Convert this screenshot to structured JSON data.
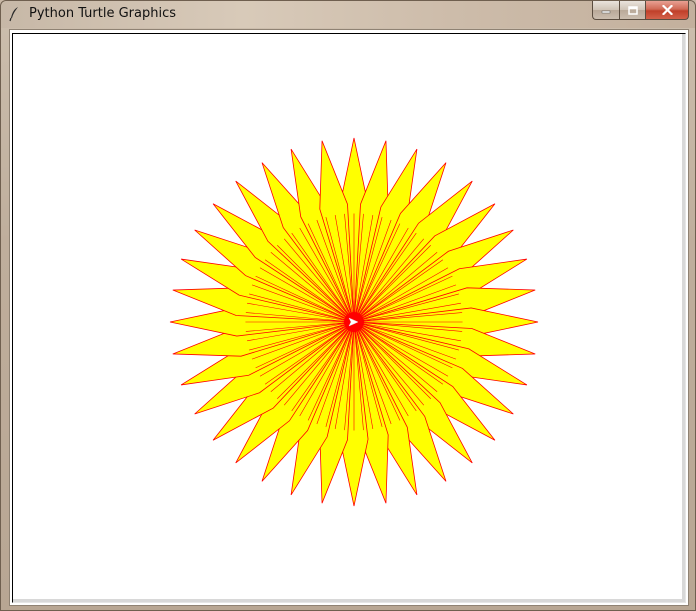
{
  "window": {
    "title": "Python Turtle Graphics",
    "controls": {
      "minimize_glyph": "—",
      "maximize_glyph": "□",
      "close_glyph": "✕"
    }
  },
  "icons": {
    "app": "feather-icon",
    "minimize": "minimize-icon",
    "maximize": "maximize-icon",
    "close": "close-icon",
    "turtle_cursor": "turtle-arrow-icon"
  },
  "drawing": {
    "shape": "star-flower",
    "points": 36,
    "fill_color": "#ffff00",
    "pen_color": "#ff0000",
    "background": "#ffffff"
  }
}
